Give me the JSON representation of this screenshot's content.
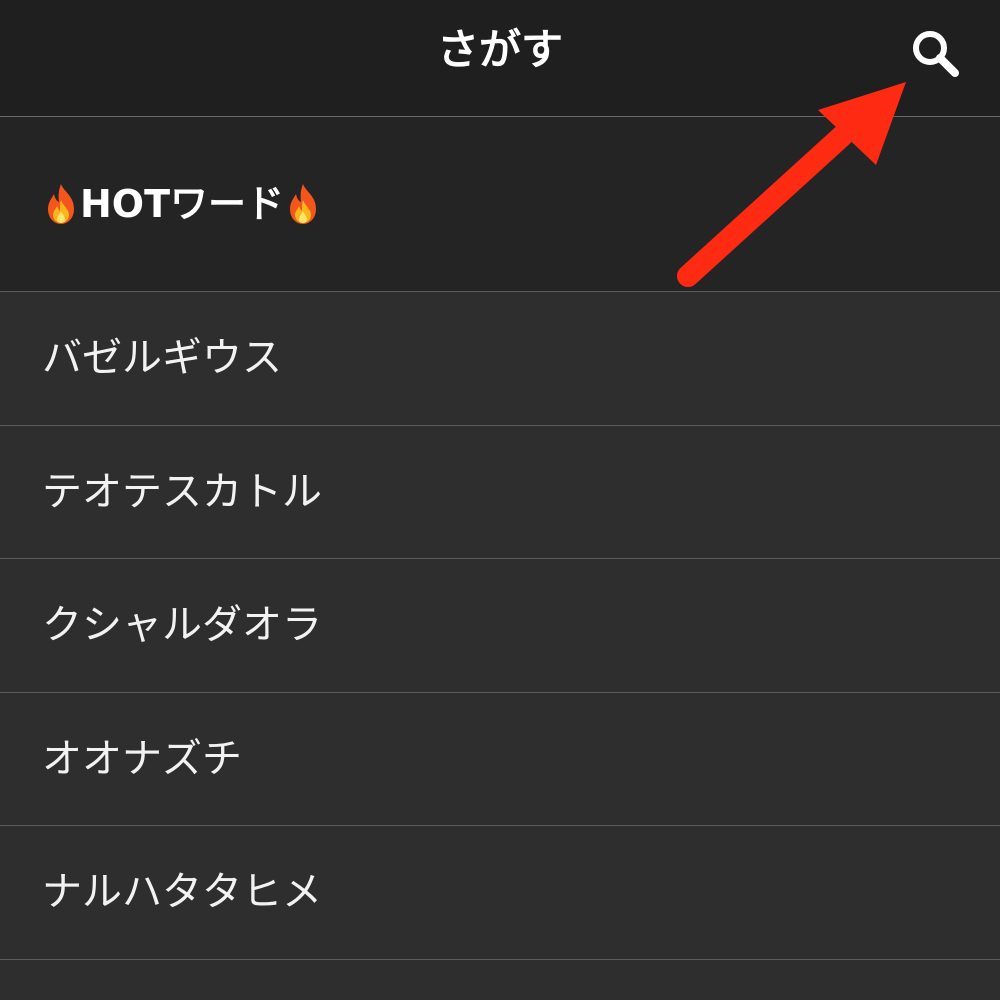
{
  "header": {
    "title": "さがす",
    "search_icon": "search-icon"
  },
  "hot_words": {
    "heading": "HOTワード",
    "heading_icon": "fire-icon"
  },
  "list": {
    "items": [
      {
        "label": "バゼルギウス"
      },
      {
        "label": "テオテスカトル"
      },
      {
        "label": "クシャルダオラ"
      },
      {
        "label": "オオナズチ"
      },
      {
        "label": "ナルハタタヒメ"
      }
    ]
  },
  "annotation": {
    "arrow_color": "#ff2a12",
    "target": "search-icon"
  },
  "colors": {
    "nav_background": "#1f1f1f",
    "hot_background": "#242424",
    "list_background": "#2e2e2e",
    "divider": "#5c5c5c",
    "text": "#ffffff"
  }
}
